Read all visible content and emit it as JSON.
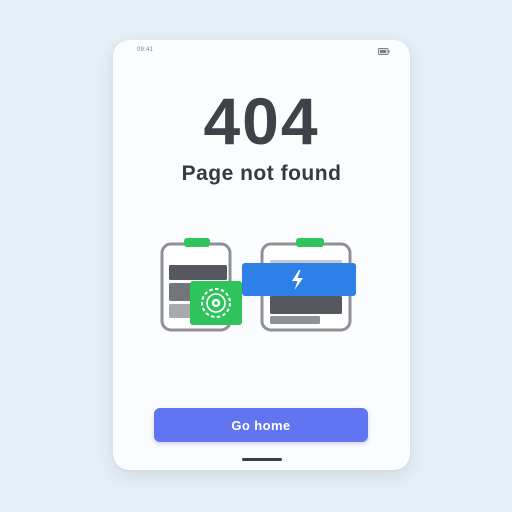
{
  "status_bar": {
    "time": "09:41",
    "battery_icon": "battery-icon"
  },
  "error": {
    "code": "404",
    "message": "Page not found"
  },
  "illustration": {
    "icons": [
      "empty-device-icon",
      "settings-gear-icon",
      "lightning-icon"
    ],
    "colors": {
      "green": "#2fc35c",
      "blue": "#2f7fe8",
      "frame": "#8e9196"
    }
  },
  "actions": {
    "go_home_label": "Go home"
  },
  "theme": {
    "accent": "#6275f0",
    "background": "#e4eff6",
    "surface": "#fbfcfd",
    "text": "#3f4248"
  }
}
